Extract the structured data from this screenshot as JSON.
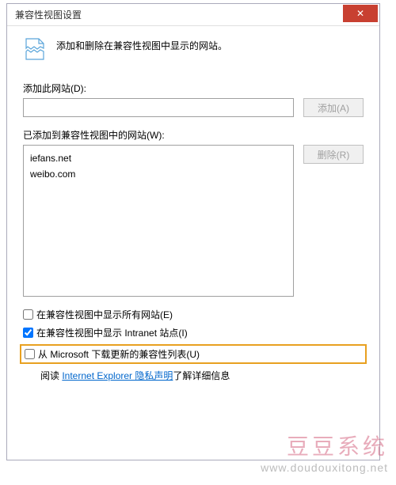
{
  "dialog": {
    "title": "兼容性视图设置",
    "header_text": "添加和删除在兼容性视图中显示的网站。"
  },
  "add_section": {
    "label": "添加此网站(D):",
    "input_value": "",
    "add_button": "添加(A)"
  },
  "list_section": {
    "label": "已添加到兼容性视图中的网站(W):",
    "items": [
      "iefans.net",
      "weibo.com"
    ],
    "remove_button": "删除(R)"
  },
  "checkboxes": {
    "show_all": {
      "label": "在兼容性视图中显示所有网站(E)",
      "checked": false
    },
    "show_intranet": {
      "label": "在兼容性视图中显示 Intranet 站点(I)",
      "checked": true
    },
    "download_updates": {
      "label": "从 Microsoft 下载更新的兼容性列表(U)",
      "checked": false
    }
  },
  "read_line": {
    "prefix": "阅读 ",
    "link": "Internet Explorer 隐私声明",
    "suffix": "了解详细信息"
  },
  "close_glyph": "✕",
  "watermark": {
    "brand": "豆豆系统",
    "url": "www.doudouxitong.net"
  }
}
